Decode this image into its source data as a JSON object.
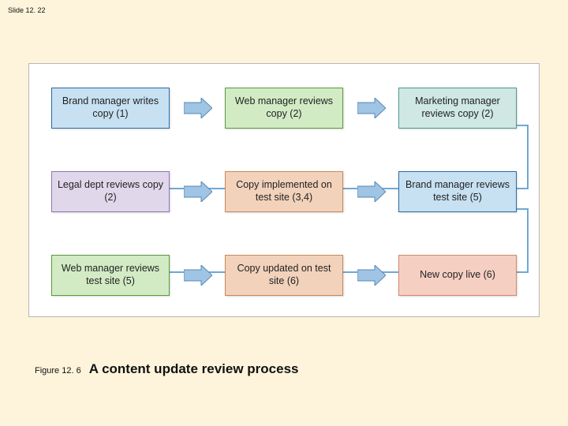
{
  "slide_number": "Slide 12. 22",
  "figure_label": "Figure 12. 6",
  "figure_title": "A content update review process",
  "nodes": {
    "r1a": "Brand manager writes copy (1)",
    "r1b": "Web manager reviews copy (2)",
    "r1c": "Marketing manager reviews copy (2)",
    "r2a": "Legal dept reviews copy (2)",
    "r2b": "Copy implemented on test site (3,4)",
    "r2c": "Brand manager reviews test site (5)",
    "r3a": "Web manager reviews test site (5)",
    "r3b": "Copy updated on test site (6)",
    "r3c": "New copy live (6)"
  },
  "chart_data": {
    "type": "flowchart",
    "title": "A content update review process",
    "nodes": [
      {
        "id": "n1",
        "label": "Brand manager writes copy (1)"
      },
      {
        "id": "n2",
        "label": "Web manager reviews copy (2)"
      },
      {
        "id": "n3",
        "label": "Marketing manager reviews copy (2)"
      },
      {
        "id": "n4",
        "label": "Legal dept reviews copy (2)"
      },
      {
        "id": "n5",
        "label": "Copy implemented on test site (3,4)"
      },
      {
        "id": "n6",
        "label": "Brand manager reviews test site (5)"
      },
      {
        "id": "n7",
        "label": "Web manager reviews test site (5)"
      },
      {
        "id": "n8",
        "label": "Copy updated on test site (6)"
      },
      {
        "id": "n9",
        "label": "New copy live (6)"
      }
    ],
    "edges": [
      {
        "from": "n1",
        "to": "n2"
      },
      {
        "from": "n2",
        "to": "n3"
      },
      {
        "from": "n3",
        "to": "n4"
      },
      {
        "from": "n4",
        "to": "n5"
      },
      {
        "from": "n5",
        "to": "n6"
      },
      {
        "from": "n6",
        "to": "n7"
      },
      {
        "from": "n7",
        "to": "n8"
      },
      {
        "from": "n8",
        "to": "n9"
      }
    ]
  }
}
